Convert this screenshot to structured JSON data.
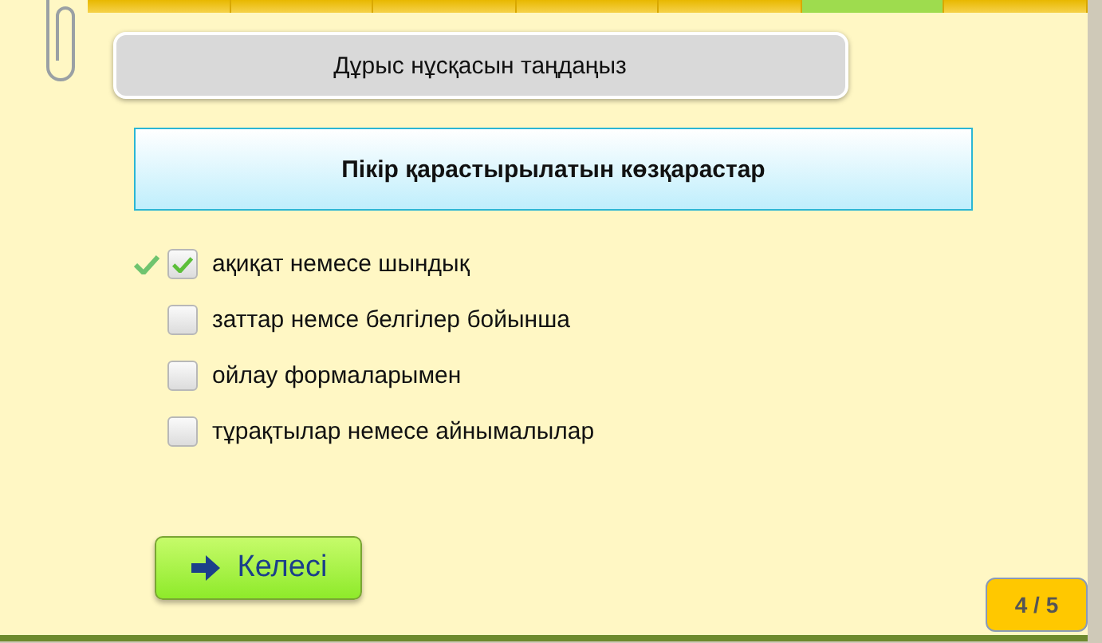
{
  "progress_segments": [
    {
      "selected": false
    },
    {
      "selected": false
    },
    {
      "selected": false
    },
    {
      "selected": false
    },
    {
      "selected": false
    },
    {
      "selected": true
    },
    {
      "selected": false
    }
  ],
  "instruction": "Дұрыс нұсқасын таңдаңыз",
  "question": "Пікір қарастырылатын көзқарастар",
  "options": [
    {
      "label": "ақиқат немесе шындық",
      "checked": true,
      "correct_mark": true
    },
    {
      "label": "заттар немсе белгілер бойынша",
      "checked": false,
      "correct_mark": false
    },
    {
      "label": "ойлау формаларымен",
      "checked": false,
      "correct_mark": false
    },
    {
      "label": "тұрақтылар немесе айнымалылар",
      "checked": false,
      "correct_mark": false
    }
  ],
  "next_button": "Келесі",
  "page_counter": "4 / 5"
}
